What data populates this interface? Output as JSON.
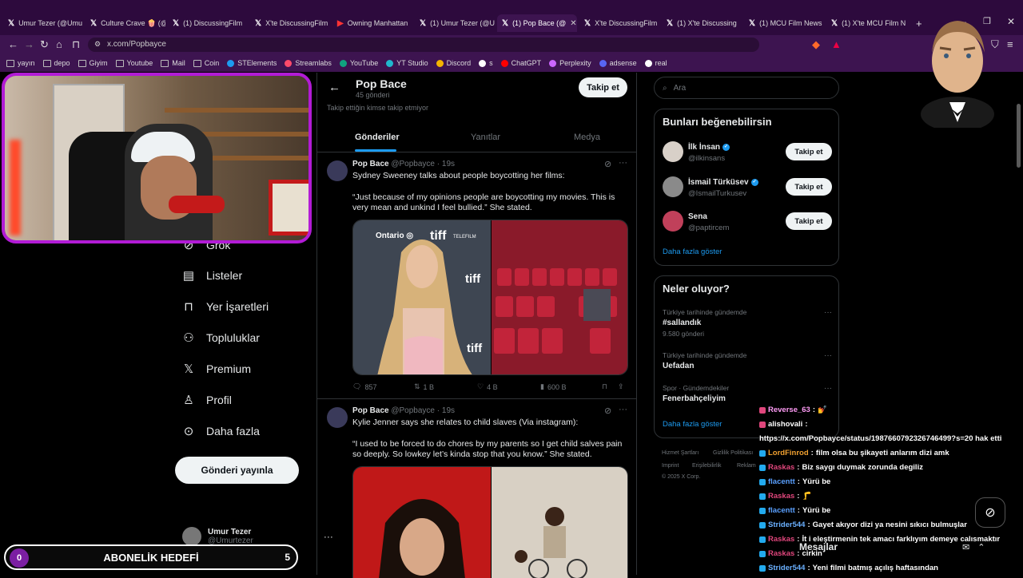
{
  "browser": {
    "tabs": [
      {
        "label": "Umur Tezer (@Umu",
        "icon": "x"
      },
      {
        "label": "Culture Crave 🍿 (@",
        "icon": "x"
      },
      {
        "label": "(1) DiscussingFilm",
        "icon": "x"
      },
      {
        "label": "X'te DiscussingFilm",
        "icon": "x"
      },
      {
        "label": "Owning Manhattan",
        "icon": "youtube"
      },
      {
        "label": "(1) Umur Tezer (@U",
        "icon": "x"
      },
      {
        "label": "(1) Pop Bace (@",
        "icon": "x",
        "active": true
      },
      {
        "label": "X'te DiscussingFilm",
        "icon": "x"
      },
      {
        "label": "(1) X'te Discussing",
        "icon": "x"
      },
      {
        "label": "(1) MCU Film News",
        "icon": "x"
      },
      {
        "label": "(1) X'te MCU Film N",
        "icon": "x"
      }
    ],
    "url": "x.com/Popbayce",
    "bookmarks": [
      "yayın",
      "depo",
      "Giyim",
      "Youtube",
      "Mail",
      "Coin",
      "STElements",
      "Streamlabs",
      "YouTube",
      "YT Studio",
      "Discord",
      "s",
      "ChatGPT",
      "Perplexity",
      "adsense",
      "real"
    ]
  },
  "left_nav": {
    "partial": "Grok",
    "items": [
      {
        "label": "Listeler",
        "icon": "list-icon",
        "glyph": "▤"
      },
      {
        "label": "Yer İşaretleri",
        "icon": "bookmark-icon",
        "glyph": "⊓"
      },
      {
        "label": "Topluluklar",
        "icon": "communities-icon",
        "glyph": "⚇"
      },
      {
        "label": "Premium",
        "icon": "x-logo-icon",
        "glyph": "𝕏"
      },
      {
        "label": "Profil",
        "icon": "profile-icon",
        "glyph": "♙"
      },
      {
        "label": "Daha fazla",
        "icon": "more-circle-icon",
        "glyph": "⊙"
      }
    ],
    "post_button": "Gönderi yayınla",
    "account": {
      "name": "Umur Tezer",
      "handle": "@Umurtezer"
    }
  },
  "profile": {
    "name": "Pop Bace",
    "post_count": "45 gönderi",
    "follow_label": "Takip et",
    "follow_note": "Takip ettiğin kimse takip etmiyor",
    "tabs": [
      "Gönderiler",
      "Yanıtlar",
      "Medya"
    ]
  },
  "tweets": [
    {
      "name": "Pop Bace",
      "handle": "@Popbayce",
      "time": "19s",
      "line1": "Sydney Sweeney talks about people boycotting her films:",
      "quote": "“Just because of my opinions people are boycotting my movies. This is very mean and unkind I feel bullied.” She stated.",
      "replies": "857",
      "reposts": "1 B",
      "likes": "4 B",
      "views": "600 B"
    },
    {
      "name": "Pop Bace",
      "handle": "@Popbayce",
      "time": "19s",
      "line1": "Kylie Jenner says she relates to child slaves (Via instagram):",
      "quote": "“I used to be forced to do chores by my parents so I get child salves pain so deeply. So lowkey let’s kinda stop that you know.” She stated."
    }
  ],
  "right": {
    "search_placeholder": "Ara",
    "who_to_follow_title": "Bunları beğenebilirsin",
    "suggestions": [
      {
        "name": "İlk İnsan",
        "handle": "@ilkinsans",
        "button": "Takip et",
        "verified": true
      },
      {
        "name": "İsmail Türküsev",
        "handle": "@IsmailTurkusev",
        "button": "Takip et",
        "verified": true
      },
      {
        "name": "Sena",
        "handle": "@paptircem",
        "button": "Takip et",
        "verified": false
      }
    ],
    "show_more": "Daha fazla göster",
    "trends_title": "Neler oluyor?",
    "trends": [
      {
        "context": "Türkiye tarihinde gündemde",
        "name": "#sallandık",
        "count": "9.580 gönderi"
      },
      {
        "context": "Türkiye tarihinde gündemde",
        "name": "Uefadan",
        "count": ""
      },
      {
        "context": "Spor · Gündemdekiler",
        "name": "Fenerbahçeliyim",
        "count": ""
      }
    ],
    "trends_more": "Daha fazla göster",
    "footer": [
      "Hizmet Şartları",
      "Gizlilik Politikası",
      "Imprint",
      "Erişilebilirlik",
      "Reklam",
      "© 2025 X Corp."
    ]
  },
  "stream_overlay": {
    "sub_goal_label": "ABONELİK HEDEFİ",
    "sub_current": "0",
    "sub_target": "5",
    "messages_label": "Mesajlar",
    "chat": [
      {
        "user": "Reverse_63",
        "msg": "💅",
        "color": "#ff9bf5"
      },
      {
        "user": "alishovali",
        "msg": "",
        "color": "#ffffff"
      },
      {
        "user": "",
        "msg": "https://x.com/Popbayce/status/1987660792326746499?s=20 hak etti",
        "color": "#ffffff"
      },
      {
        "user": "LordFinrod",
        "msg": "film olsa bu şikayeti anlarım dizi amk",
        "color": "#f0a030"
      },
      {
        "user": "Raskas",
        "msg": "Biz saygı duymak zorunda degiliz",
        "color": "#e0467c"
      },
      {
        "user": "flacentt",
        "msg": "Yürü be",
        "color": "#5aa0ff"
      },
      {
        "user": "Raskas",
        "msg": "🦵",
        "color": "#e0467c"
      },
      {
        "user": "flacentt",
        "msg": "Yürü be",
        "color": "#5aa0ff"
      },
      {
        "user": "Strider544",
        "msg": "Gayet akıyor dizi ya nesini sıkıcı bulmuşlar",
        "color": "#6ab0ff"
      },
      {
        "user": "Raskas",
        "msg": "İt i eleştirmenin tek amacı farklıyım demeye calısmaktır",
        "color": "#e0467c"
      },
      {
        "user": "Raskas",
        "msg": "cirkin",
        "color": "#e0467c"
      },
      {
        "user": "Strider544",
        "msg": "Yeni filmi batmış açılış haftasından",
        "color": "#6ab0ff"
      }
    ]
  }
}
